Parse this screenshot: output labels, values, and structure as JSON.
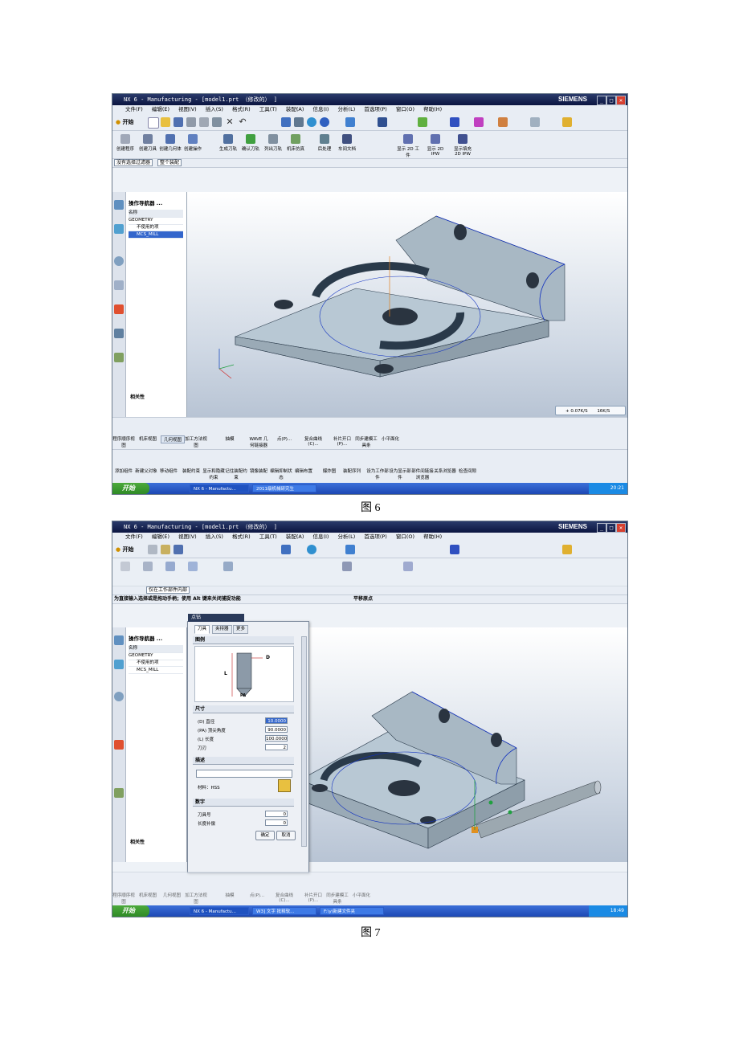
{
  "figure6": {
    "caption": "图 6",
    "window": {
      "title": "NX 6 - Manufacturing - [model1.prt （修改的） ]",
      "brand": "SIEMENS",
      "menu": [
        "文件(F)",
        "编辑(E)",
        "视图(V)",
        "插入(S)",
        "格式(R)",
        "工具(T)",
        "装配(A)",
        "信息(I)",
        "分析(L)",
        "首选项(P)",
        "窗口(O)",
        "帮助(H)"
      ],
      "start_label": "开始",
      "toolbar_labels": [
        "创建程序",
        "创建刀具",
        "创建几何体",
        "创建操作",
        "生成刀轨",
        "确认刀轨",
        "列出刀轨",
        "机床仿真",
        "后处理",
        "车间文档",
        "显示 2D 工件",
        "显示 2D IPW",
        "显示填充 2D IPW"
      ],
      "filter_label": "没有选择过滤器",
      "scope_label": "整个装配"
    },
    "navigator": {
      "title": "操作导航器 ...",
      "column_header": "名称",
      "rows": [
        "GEOMETRY",
        "不使用的项",
        "MCS_MILL"
      ],
      "related_label": "相关性"
    },
    "status_readout": "+ 0.07K/S",
    "status_readout_2": "16K/S",
    "bottom_toolbar_labels": [
      "程序顺序视图",
      "机床视图",
      "几何视图",
      "加工方法视图",
      "抽模",
      "WAVE 几何链接器",
      "点(P)...",
      "复合曲线(C)...",
      "补片开口(P)...",
      "同步建模工具条",
      "小平面化"
    ],
    "assembly_toolbar_labels": [
      "添加组件",
      "新建父对象",
      "移动组件",
      "装配约束",
      "显示和隐藏约束",
      "记住装配约束",
      "镜像装配",
      "编辑抑制状态",
      "编辑布置",
      "爆炸图",
      "装配序列",
      "设为工作部件",
      "设为显示部件",
      "部件间链接浏览器",
      "关系浏览器",
      "检查间隙"
    ],
    "taskbar": {
      "start": "开始",
      "tasks": [
        "NX 6 - Manufactu...",
        "2011级机械研究生"
      ],
      "clock": "20:21"
    }
  },
  "figure7": {
    "caption": "图 7",
    "window": {
      "title": "NX 6 - Manufacturing - [model1.prt （修改的） ]",
      "brand": "SIEMENS",
      "menu": [
        "文件(F)",
        "编辑(E)",
        "视图(V)",
        "插入(S)",
        "格式(R)",
        "工具(T)",
        "装配(A)",
        "信息(I)",
        "分析(L)",
        "首选项(P)",
        "窗口(O)",
        "帮助(H)"
      ],
      "start_label": "开始",
      "filter_label": "仅在工作部件内部",
      "prompt": "为直接输入选择或是拖动手柄；使用 Alt 键来关闭捕捉功能",
      "prompt_right": "平移原点",
      "point_box_label": "点钻"
    },
    "navigator": {
      "title": "操作导航器 ...",
      "column_header": "名称",
      "rows": [
        "GEOMETRY",
        "不使用的项",
        "MCS_MILL"
      ],
      "related_label": "相关性"
    },
    "dialog": {
      "tabs": [
        "刀具",
        "夹持器",
        "更多"
      ],
      "sections": {
        "diagram": "图例",
        "dimensions": "尺寸",
        "description": "描述",
        "numbers": "数字"
      },
      "diagram_labels": {
        "d": "D",
        "l": "L",
        "pa": "PA"
      },
      "fields": [
        {
          "label": "(D) 直径",
          "value": "10.0000"
        },
        {
          "label": "(PA) 顶尖角度",
          "value": "90.0000"
        },
        {
          "label": "(L) 长度",
          "value": "100.0000"
        },
        {
          "label": "刀刃",
          "value": "2"
        }
      ],
      "material_label": "材料：",
      "material_value": "HSS",
      "number_fields": [
        {
          "label": "刀具号",
          "value": "0"
        },
        {
          "label": "长度补偿",
          "value": "0"
        }
      ],
      "ok": "确定",
      "cancel": "取消"
    },
    "bottom_toolbar_labels": [
      "程序顺序视图",
      "机床视图",
      "几何视图",
      "加工方法视图",
      "抽模",
      "点(P)...",
      "复合曲线(C)...",
      "补片开口(P)...",
      "同步建模工具条",
      "小平面化"
    ],
    "taskbar": {
      "start": "开始",
      "tasks": [
        "NX 6 - Manufactu...",
        "W3] 文字 批释软...",
        "F:\\y\\新建文件夹"
      ],
      "clock": "18:49"
    }
  },
  "colors": {
    "titlebar": "#0b1540",
    "taskbar": "#1d48b4",
    "part_face": "#a8b8c4",
    "part_top": "#b8c8d4",
    "edge_blue": "#1030c0"
  }
}
